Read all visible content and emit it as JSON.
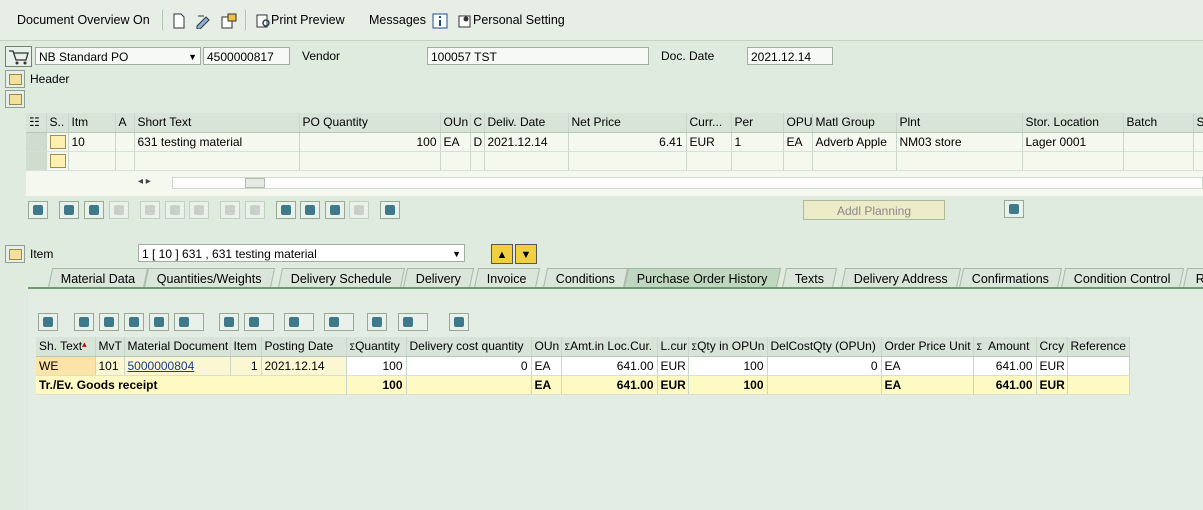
{
  "toolbar": {
    "doc_overview": "Document Overview On",
    "print_preview": "Print Preview",
    "messages": "Messages",
    "personal_setting": "Personal Setting"
  },
  "header": {
    "po_type": "NB Standard PO",
    "po_number": "4500000817",
    "vendor_label": "Vendor",
    "vendor_value": "100057 TST",
    "doc_date_label": "Doc. Date",
    "doc_date_value": "2021.12.14",
    "header_label": "Header"
  },
  "items_table": {
    "columns": [
      "S..",
      "Itm",
      "A",
      "Short Text",
      "PO Quantity",
      "OUn",
      "C",
      "Deliv. Date",
      "Net Price",
      "Curr...",
      "Per",
      "OPU",
      "Matl Group",
      "Plnt",
      "Stor. Location",
      "Batch",
      "St"
    ],
    "rows": [
      {
        "itm": "10",
        "a": "",
        "short_text": "631 testing material",
        "po_qty": "100",
        "oun": "EA",
        "c": "D",
        "deliv_date": "2021.12.14",
        "net_price": "6.41",
        "curr": "EUR",
        "per": "1",
        "opu": "EA",
        "matl_group": "Adverb Apple",
        "plnt": "NM03 store",
        "stor_loc": "Lager 0001",
        "batch": ""
      }
    ]
  },
  "addl_planning": "Addl Planning",
  "item_selector": {
    "label": "Item",
    "value": "1 [ 10 ] 631 , 631 testing material"
  },
  "tabs": [
    "Material Data",
    "Quantities/Weights",
    "Delivery Schedule",
    "Delivery",
    "Invoice",
    "Conditions",
    "Purchase Order History",
    "Texts",
    "Delivery Address",
    "Confirmations",
    "Condition Control",
    "R"
  ],
  "active_tab": "Purchase Order History",
  "history_table": {
    "columns": [
      "Sh. Text",
      "MvT",
      "Material Document",
      "Item",
      "Posting Date",
      "Quantity",
      "Delivery cost quantity",
      "OUn",
      "Amt.in Loc.Cur.",
      "L.cur",
      "Qty in OPUn",
      "DelCostQty (OPUn)",
      "Order Price Unit",
      "Amount",
      "Crcy",
      "Reference"
    ],
    "sum_marker": "Σ",
    "row": {
      "sh_text": "WE",
      "mvt": "101",
      "mat_doc": "5000000804",
      "item": "1",
      "posting_date": "2021.12.14",
      "quantity": "100",
      "del_cost_qty": "0",
      "oun": "EA",
      "amt_loc": "641.00",
      "lcur": "EUR",
      "qty_opun": "100",
      "delcost_opun": "0",
      "order_price_unit": "EA",
      "amount": "641.00",
      "crcy": "EUR",
      "reference": ""
    },
    "total": {
      "label": "Tr./Ev. Goods receipt",
      "quantity": "100",
      "oun": "EA",
      "amt_loc": "641.00",
      "lcur": "EUR",
      "qty_opun": "100",
      "order_price_unit": "EA",
      "amount": "641.00",
      "crcy": "EUR"
    }
  },
  "colors": {
    "background": "#dfebdf",
    "header_bg": "#d8e4d8",
    "total_row": "#fff9c4",
    "link": "#1a3c8c"
  }
}
